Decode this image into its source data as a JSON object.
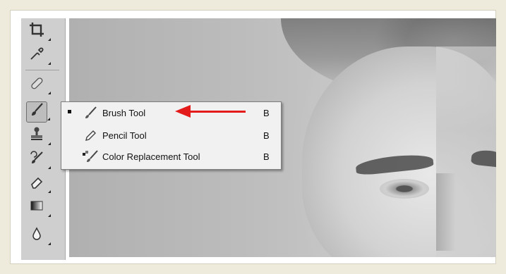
{
  "toolbar": {
    "tools": [
      {
        "name": "crop-tool",
        "icon": "crop-icon"
      },
      {
        "name": "eyedropper-tool",
        "icon": "eyedropper-icon"
      },
      {
        "name": "healing-brush-tool",
        "icon": "bandage-icon"
      },
      {
        "name": "brush-tool",
        "icon": "brush-icon",
        "active": true
      },
      {
        "name": "clone-stamp-tool",
        "icon": "stamp-icon"
      },
      {
        "name": "history-brush-tool",
        "icon": "history-brush-icon"
      },
      {
        "name": "eraser-tool",
        "icon": "eraser-icon"
      },
      {
        "name": "gradient-tool",
        "icon": "gradient-icon"
      },
      {
        "name": "blur-tool",
        "icon": "drop-icon"
      }
    ]
  },
  "flyout": {
    "items": [
      {
        "label": "Brush Tool",
        "shortcut": "B",
        "icon": "brush-icon",
        "selected": true
      },
      {
        "label": "Pencil Tool",
        "shortcut": "B",
        "icon": "pencil-icon",
        "selected": false
      },
      {
        "label": "Color Replacement Tool",
        "shortcut": "B",
        "icon": "color-replacement-icon",
        "selected": false
      }
    ]
  },
  "colors": {
    "annotation_arrow": "#e31b1b",
    "toolbar_bg": "#cfcfcf",
    "menu_bg": "#f1f1f1"
  }
}
